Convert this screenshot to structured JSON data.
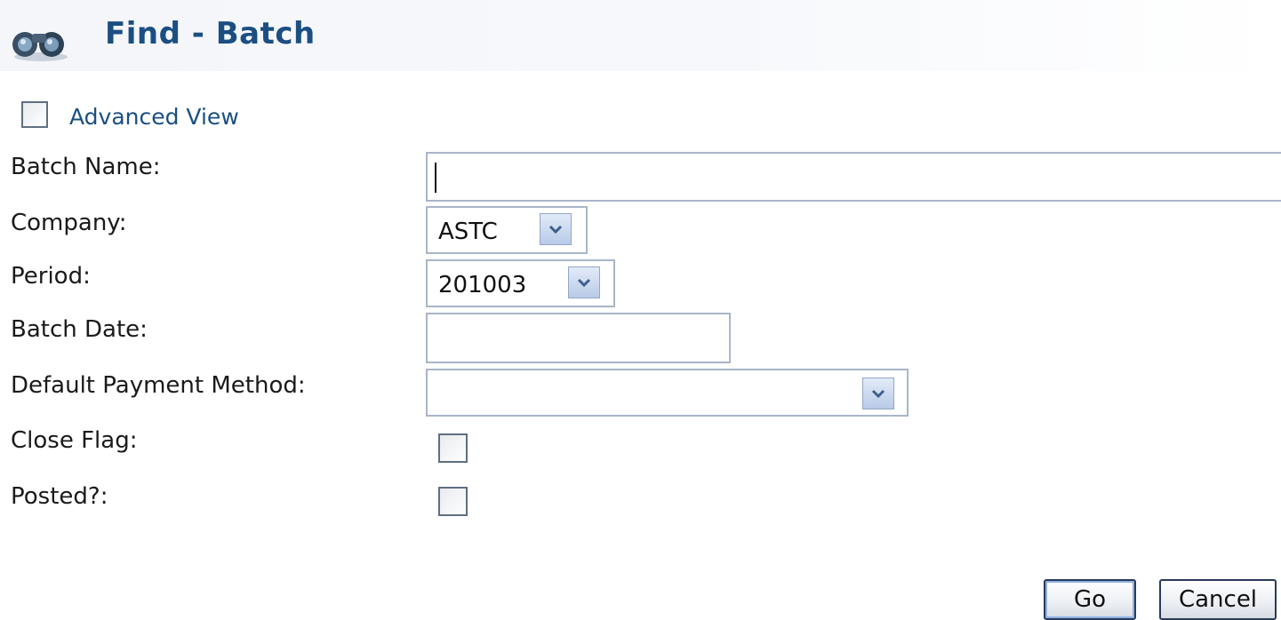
{
  "header": {
    "title": "Find - Batch",
    "icon": "binoculars-icon"
  },
  "advanced_view": {
    "label": "Advanced View",
    "checked": false
  },
  "fields": {
    "batch_name": {
      "label": "Batch Name:",
      "value": ""
    },
    "company": {
      "label": "Company:",
      "value": "ASTC"
    },
    "period": {
      "label": "Period:",
      "value": "201003"
    },
    "batch_date": {
      "label": "Batch Date:",
      "value": ""
    },
    "default_payment_method": {
      "label": "Default Payment Method:",
      "value": ""
    },
    "close_flag": {
      "label": "Close Flag:",
      "checked": false
    },
    "posted": {
      "label": "Posted?:",
      "checked": false
    }
  },
  "buttons": {
    "go": "Go",
    "cancel": "Cancel"
  },
  "colors": {
    "title": "#1b4f82",
    "field_border": "#a8b6c8",
    "dropdown_button": "#c6d5ee"
  }
}
